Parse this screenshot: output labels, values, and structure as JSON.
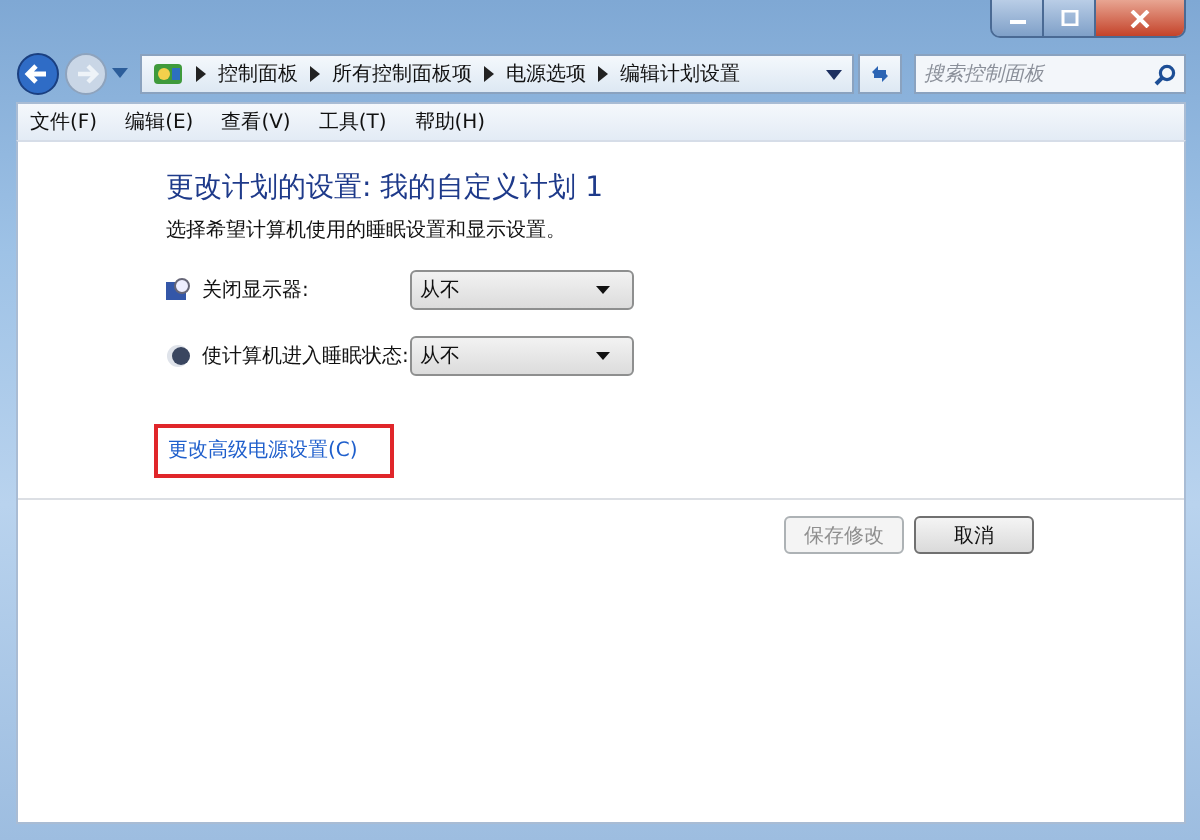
{
  "breadcrumb": [
    "控制面板",
    "所有控制面板项",
    "电源选项",
    "编辑计划设置"
  ],
  "search": {
    "placeholder": "搜索控制面板"
  },
  "menu": [
    "文件(F)",
    "编辑(E)",
    "查看(V)",
    "工具(T)",
    "帮助(H)"
  ],
  "heading": "更改计划的设置: 我的自定义计划 1",
  "description": "选择希望计算机使用的睡眠设置和显示设置。",
  "settings": [
    {
      "kind": "display",
      "label": "关闭显示器:",
      "value": "从不"
    },
    {
      "kind": "sleep",
      "label": "使计算机进入睡眠状态:",
      "value": "从不"
    }
  ],
  "advanced_link": {
    "label": "更改高级电源设置(C)",
    "highlighted": true
  },
  "buttons": [
    {
      "label": "保存修改",
      "disabled": true
    },
    {
      "label": "取消",
      "disabled": false
    }
  ]
}
